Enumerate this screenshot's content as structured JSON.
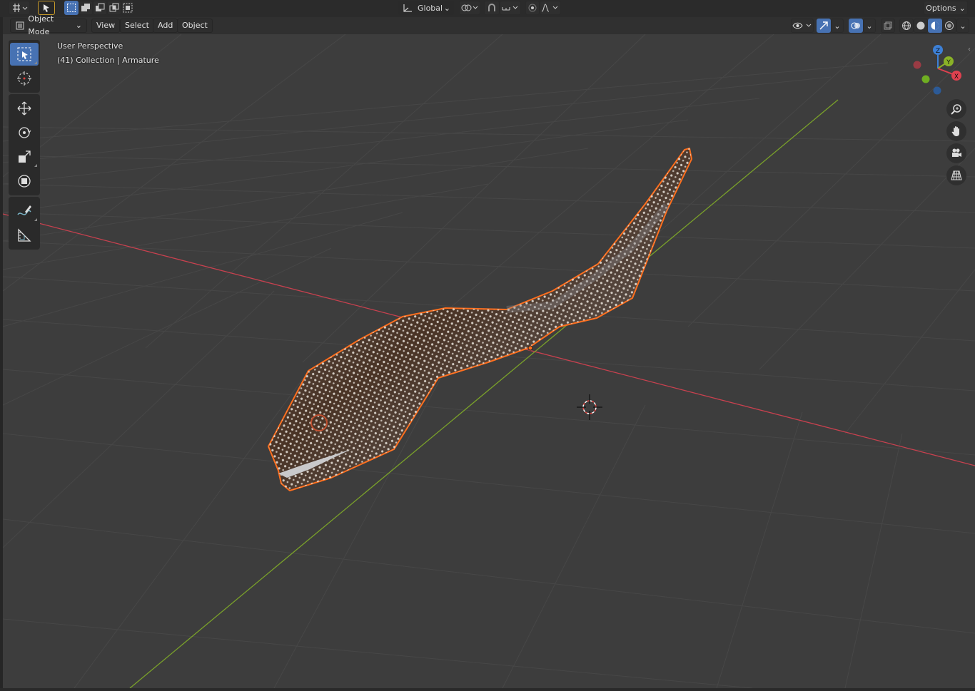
{
  "topbar": {
    "orientation": "Global",
    "options_label": "Options"
  },
  "header": {
    "mode": "Object Mode",
    "menus": [
      "View",
      "Select",
      "Add",
      "Object"
    ]
  },
  "viewport": {
    "perspective_label": "User Perspective",
    "collection_label": "(41) Collection | Armature",
    "gizmo_axes": [
      "Z",
      "Y",
      "X"
    ]
  },
  "colors": {
    "background": "#3d3d3d",
    "x_axis": "#c8414f",
    "y_axis": "#7aa12a",
    "selection_outline": "#ff6f1e",
    "active_tool": "#4772b3"
  },
  "tools": [
    "select-box-icon",
    "cursor-icon",
    "move-icon",
    "rotate-icon",
    "scale-icon",
    "transform-icon",
    "annotate-icon",
    "measure-icon"
  ]
}
